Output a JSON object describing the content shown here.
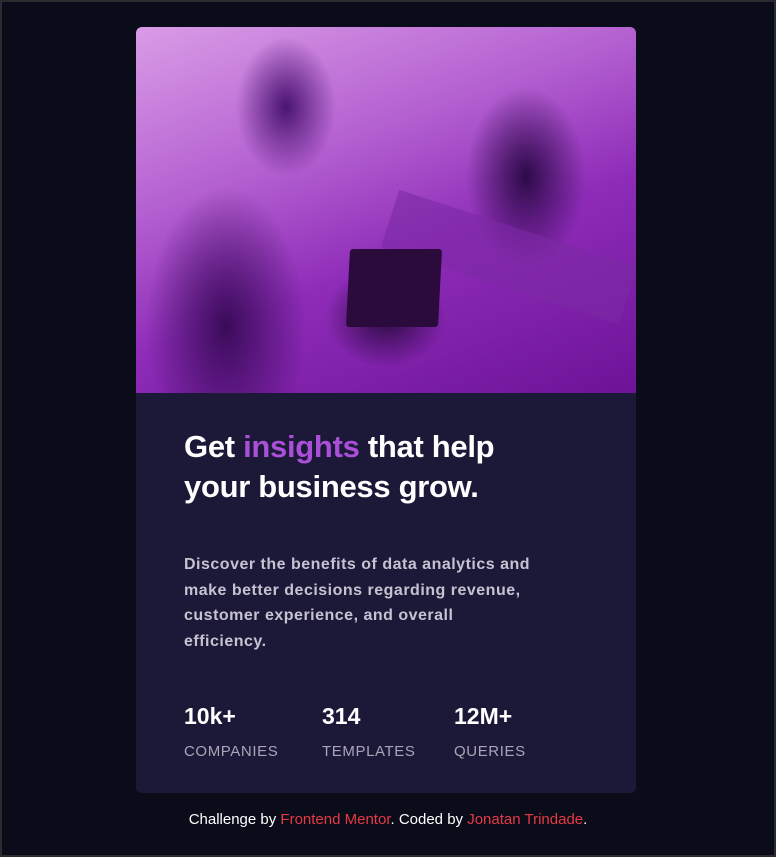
{
  "card": {
    "image_alt": "People working on laptops at a shared table",
    "title_before": "Get ",
    "title_accent": "insights",
    "title_after": " that help your business grow.",
    "description": "Discover the benefits of data analytics and make better decisions regarding revenue, customer experience, and overall efficiency.",
    "stats": [
      {
        "value": "10k+",
        "label": "COMPANIES"
      },
      {
        "value": "314",
        "label": "TEMPLATES"
      },
      {
        "value": "12M+",
        "label": "QUERIES"
      }
    ]
  },
  "attribution": {
    "prefix": "Challenge by ",
    "link1": "Frontend Mentor",
    "middle": ". Coded by ",
    "link2": "Jonatan Trindade",
    "suffix": "."
  },
  "colors": {
    "accent": "#a94fd8",
    "card": "#1c1938",
    "background": "#0b0c19",
    "link": "#e63946"
  }
}
